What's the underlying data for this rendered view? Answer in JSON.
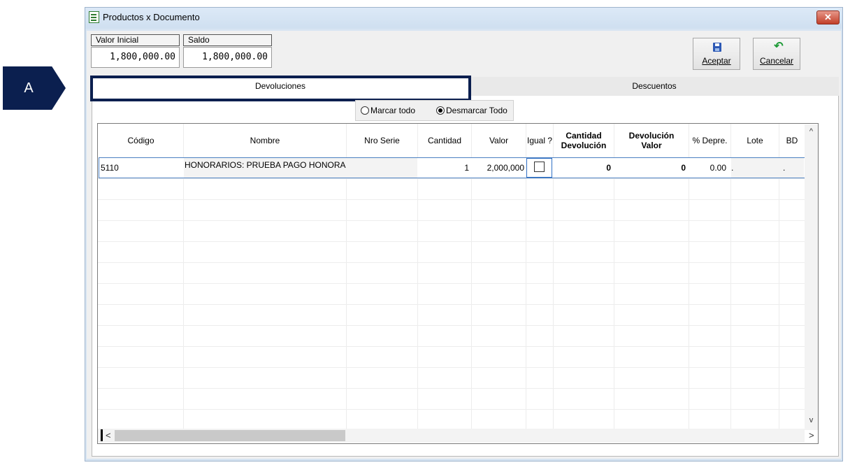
{
  "annotation": {
    "label": "A"
  },
  "window": {
    "title": "Productos x Documento",
    "close_glyph": "✕"
  },
  "amounts": {
    "initial": {
      "label": "Valor Inicial",
      "value": "1,800,000.00"
    },
    "balance": {
      "label": "Saldo",
      "value": "1,800,000.00"
    }
  },
  "toolbar": {
    "accept_label": "Aceptar",
    "cancel_label": "Cancelar"
  },
  "tabs": [
    {
      "label": "Devoluciones",
      "active": true
    },
    {
      "label": "Descuentos",
      "active": false
    }
  ],
  "selection": {
    "select_all_label": "Marcar todo",
    "deselect_all_label": "Desmarcar Todo",
    "selected": "Desmarcar Todo"
  },
  "grid": {
    "columns": {
      "codigo": "Código",
      "nombre": "Nombre",
      "nro_serie": "Nro Serie",
      "cantidad": "Cantidad",
      "valor": "Valor",
      "igual": "Igual ?",
      "cantidad_devolucion_1": "Cantidad",
      "cantidad_devolucion_2": "Devolución",
      "devolucion_valor_1": "Devolución",
      "devolucion_valor_2": "Valor",
      "depre": "% Depre.",
      "lote": "Lote",
      "bd": "BD"
    },
    "rows": [
      {
        "codigo": "5110",
        "nombre": "HONORARIOS: PRUEBA PAGO HONORARIOS",
        "nro_serie": "",
        "cantidad": "1",
        "valor": "2,000,000",
        "igual": false,
        "cantidad_devolucion": "0",
        "devolucion_valor": "0",
        "depre": "0.00",
        "lote": ".",
        "bd": "."
      }
    ]
  },
  "scroll": {
    "up": "^",
    "down": "v",
    "left": "<",
    "right": ">"
  },
  "colors": {
    "accent": "#0b1f4f",
    "window_frame": "#d7e4f2",
    "selection_border": "#4a7fc1"
  }
}
